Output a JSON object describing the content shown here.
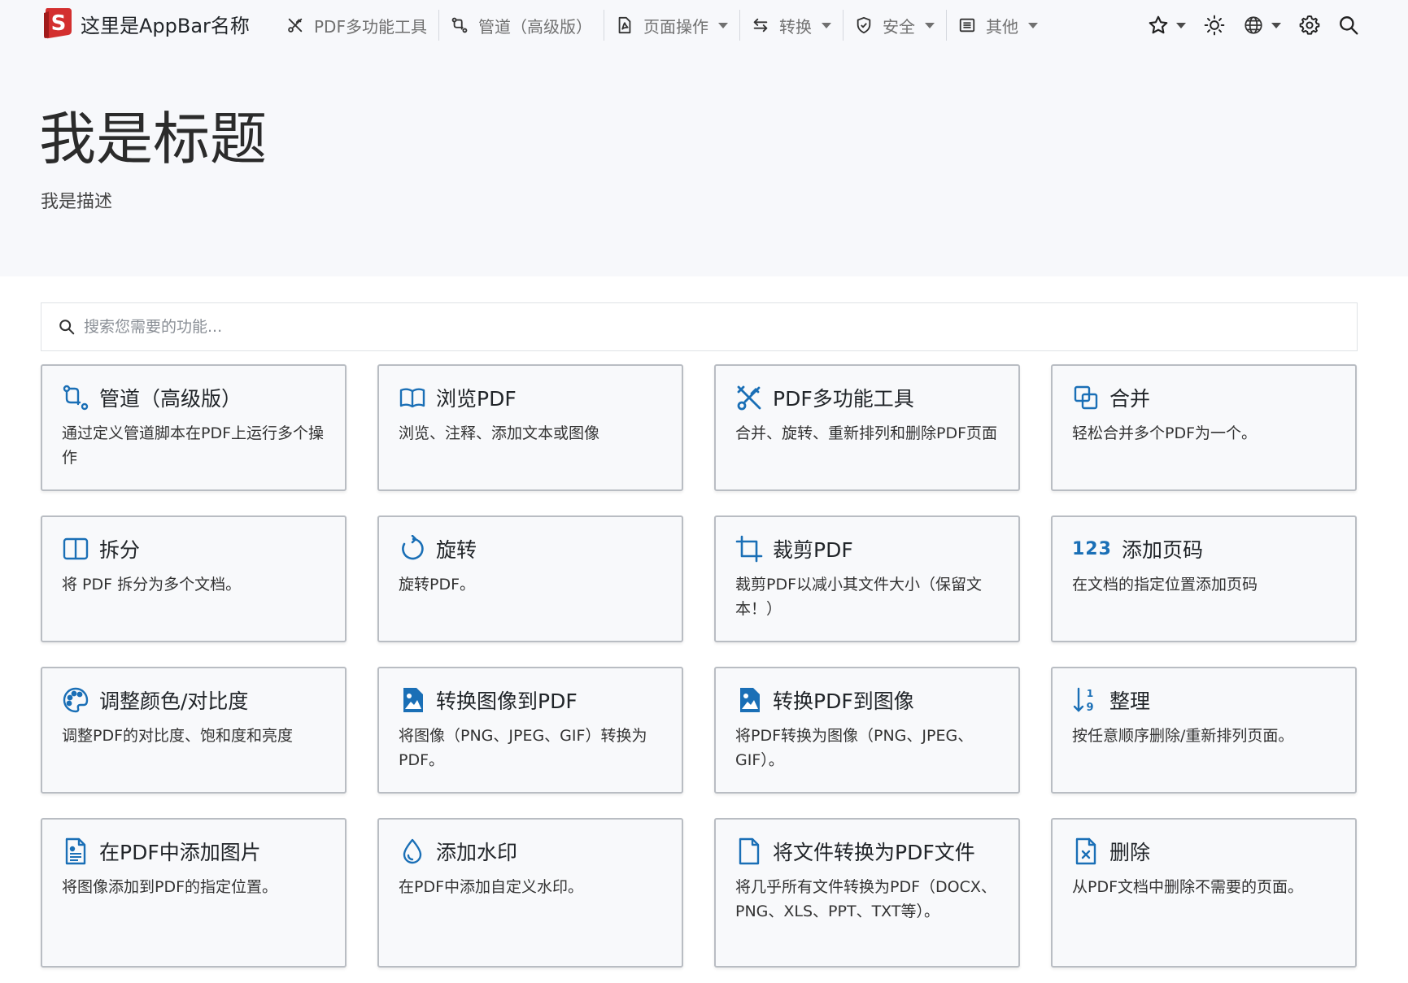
{
  "colors": {
    "accent": "#1a6fb6",
    "logo_red": "#d32f2f",
    "hero_bg": "#f7f8fb"
  },
  "appbar": {
    "logo_icon": "stirling-logo-icon",
    "name": "这里是AppBar名称",
    "nav": [
      {
        "label": "PDF多功能工具",
        "icon": "scissors-tools-icon",
        "caret": false
      },
      {
        "label": "管道（高级版）",
        "icon": "pipeline-icon",
        "caret": false
      },
      {
        "label": "页面操作",
        "icon": "file-pdf-icon",
        "caret": true
      },
      {
        "label": "转换",
        "icon": "arrows-swap-icon",
        "caret": true
      },
      {
        "label": "安全",
        "icon": "shield-icon",
        "caret": true
      },
      {
        "label": "其他",
        "icon": "list-icon",
        "caret": true
      }
    ],
    "right_icons": [
      "star-icon",
      "sun-icon",
      "globe-icon",
      "gear-icon",
      "search-icon"
    ]
  },
  "hero": {
    "title": "我是标题",
    "description": "我是描述"
  },
  "search": {
    "placeholder": "搜索您需要的功能..."
  },
  "cards": [
    {
      "icon": "pipeline-icon",
      "title": "管道（高级版）",
      "desc": "通过定义管道脚本在PDF上运行多个操作"
    },
    {
      "icon": "book-icon",
      "title": "浏览PDF",
      "desc": "浏览、注释、添加文本或图像"
    },
    {
      "icon": "tools-icon",
      "title": "PDF多功能工具",
      "desc": "合并、旋转、重新排列和删除PDF页面"
    },
    {
      "icon": "merge-icon",
      "title": "合并",
      "desc": "轻松合并多个PDF为一个。"
    },
    {
      "icon": "split-icon",
      "title": "拆分",
      "desc": "将 PDF 拆分为多个文档。"
    },
    {
      "icon": "rotate-icon",
      "title": "旋转",
      "desc": "旋转PDF。"
    },
    {
      "icon": "crop-icon",
      "title": "裁剪PDF",
      "desc": "裁剪PDF以减小其文件大小（保留文本！）"
    },
    {
      "icon": "number-icon",
      "icon_text": "123",
      "title": "添加页码",
      "desc": "在文档的指定位置添加页码"
    },
    {
      "icon": "palette-icon",
      "title": "调整颜色/对比度",
      "desc": "调整PDF的对比度、饱和度和亮度"
    },
    {
      "icon": "image-icon",
      "title": "转换图像到PDF",
      "desc": "将图像（PNG、JPEG、GIF）转换为PDF。"
    },
    {
      "icon": "image-icon",
      "title": "转换PDF到图像",
      "desc": "将PDF转换为图像（PNG、JPEG、GIF）。"
    },
    {
      "icon": "sort-numeric-icon",
      "title": "整理",
      "desc": "按任意顺序删除/重新排列页面。"
    },
    {
      "icon": "file-image-icon",
      "title": "在PDF中添加图片",
      "desc": "将图像添加到PDF的指定位置。"
    },
    {
      "icon": "droplet-icon",
      "title": "添加水印",
      "desc": "在PDF中添加自定义水印。"
    },
    {
      "icon": "file-icon",
      "title": "将文件转换为PDF文件",
      "desc": "将几乎所有文件转换为PDF（DOCX、PNG、XLS、PPT、TXT等）。"
    },
    {
      "icon": "file-x-icon",
      "title": "删除",
      "desc": "从PDF文档中删除不需要的页面。"
    }
  ]
}
